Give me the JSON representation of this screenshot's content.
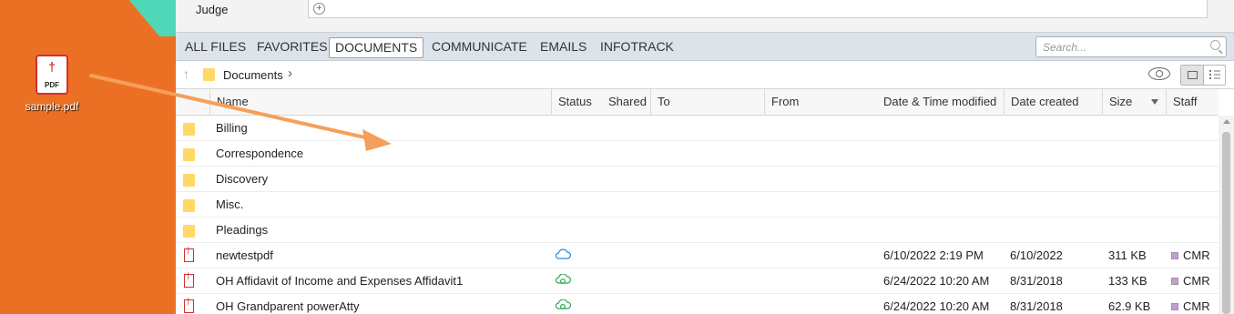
{
  "desktop": {
    "file_icon": "pdf-file-icon",
    "file_icon_text": "PDF",
    "file_name": "sample.pdf"
  },
  "judge": {
    "label": "Judge",
    "add_icon": "plus-circle-icon"
  },
  "tabs": [
    {
      "label": "ALL FILES"
    },
    {
      "label": "FAVORITES"
    },
    {
      "label": "DOCUMENTS",
      "active": true
    },
    {
      "label": "COMMUNICATE"
    },
    {
      "label": "EMAILS"
    },
    {
      "label": "INFOTRACK"
    }
  ],
  "search": {
    "placeholder": "Search..."
  },
  "path": {
    "current": "Documents"
  },
  "columns": {
    "name": "Name",
    "status": "Status",
    "shared": "Shared",
    "to": "To",
    "from": "From",
    "modified": "Date & Time modified",
    "created": "Date created",
    "size": "Size",
    "staff": "Staff"
  },
  "rows": [
    {
      "type": "folder",
      "name": "Billing"
    },
    {
      "type": "folder",
      "name": "Correspondence"
    },
    {
      "type": "folder",
      "name": "Discovery"
    },
    {
      "type": "folder",
      "name": "Misc."
    },
    {
      "type": "folder",
      "name": "Pleadings"
    },
    {
      "type": "pdf",
      "name": "newtestpdf",
      "status": "cloud-icon",
      "modified": "6/10/2022 2:19 PM",
      "created": "6/10/2022",
      "size": "311 KB",
      "staff": "CMR"
    },
    {
      "type": "pdf",
      "name": "OH Affidavit of Income and Expenses Affidavit1",
      "status": "cloud-sync-icon",
      "modified": "6/24/2022 10:20 AM",
      "created": "8/31/2018",
      "size": "133 KB",
      "staff": "CMR"
    },
    {
      "type": "pdf",
      "name": "OH Grandparent powerAtty",
      "status": "cloud-sync-icon",
      "modified": "6/24/2022 10:20 AM",
      "created": "8/31/2018",
      "size": "62.9 KB",
      "staff": "CMR"
    }
  ],
  "colors": {
    "desktop": "#ec7024",
    "accent_teal": "#4fd7b7",
    "drag_arrow": "#f5a05a",
    "folder": "#ffd866",
    "cloud_blue": "#2d8bd8",
    "cloud_green": "#34a853",
    "staff_tag": "#c99bd6"
  }
}
